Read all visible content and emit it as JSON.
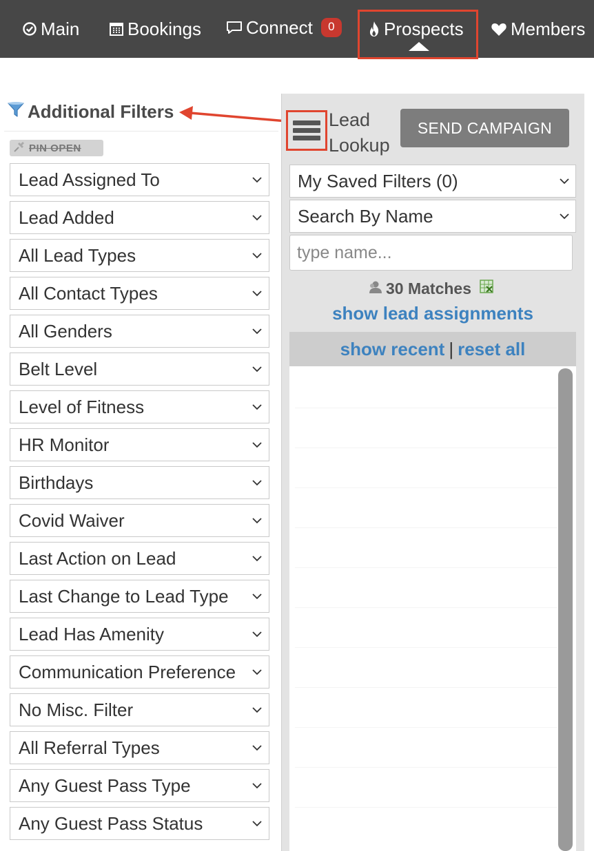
{
  "nav": {
    "items": [
      {
        "label": "Main",
        "icon": "check-circle-icon"
      },
      {
        "label": "Bookings",
        "icon": "calendar-icon"
      },
      {
        "label": "Connect",
        "icon": "speech-bubble-icon",
        "badge": "0"
      },
      {
        "label": "Prospects",
        "icon": "flame-icon",
        "active": true
      },
      {
        "label": "Members",
        "icon": "heart-icon"
      }
    ],
    "active_highlight_color": "#e0452f"
  },
  "filters": {
    "title": "Additional Filters",
    "pin_label": "PIN OPEN",
    "selects": [
      "Lead Assigned To",
      "Lead Added",
      "All Lead Types",
      "All Contact Types",
      "All Genders",
      "Belt Level",
      "Level of Fitness",
      "HR Monitor",
      "Birthdays",
      "Covid Waiver",
      "Last Action on Lead",
      "Last Change to Lead Type",
      "Lead Has Amenity",
      "Communication Preference",
      "No Misc. Filter",
      "All Referral Types",
      "Any Guest Pass Type",
      "Any Guest Pass Status"
    ]
  },
  "lookup": {
    "title_line1": "Lead",
    "title_line2": "Lookup",
    "send_button": "SEND CAMPAIGN",
    "saved_filters": "My Saved Filters (0)",
    "search_by": "Search By Name",
    "name_placeholder": "type name...",
    "matches": "30 Matches",
    "show_assignments": "show lead assignments",
    "show_recent": "show recent",
    "separator": "|",
    "reset_all": "reset all"
  },
  "colors": {
    "nav_bg": "#474747",
    "annotation_red": "#e0452f",
    "link_blue": "#3d82bf",
    "badge_red": "#c8382f",
    "button_gray": "#7d7d7d"
  }
}
